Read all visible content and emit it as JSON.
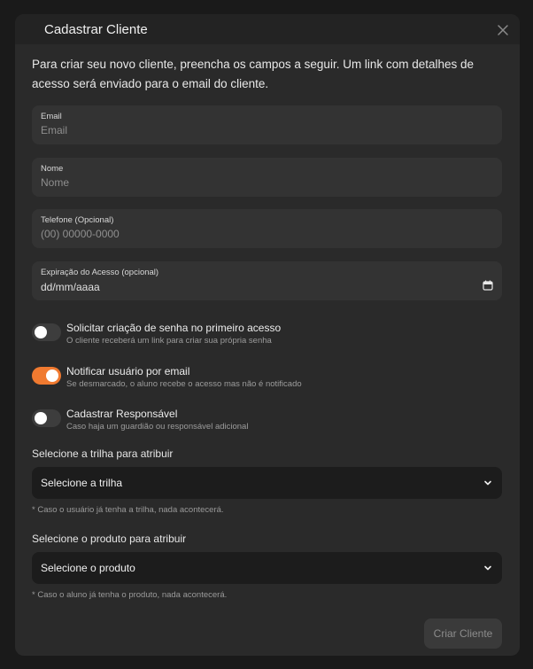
{
  "modal": {
    "title": "Cadastrar Cliente",
    "intro": "Para criar seu novo cliente, preencha os campos a seguir. Um link com detalhes de acesso será enviado para o email do cliente."
  },
  "fields": {
    "email": {
      "label": "Email",
      "placeholder": "Email"
    },
    "name": {
      "label": "Nome",
      "placeholder": "Nome"
    },
    "phone": {
      "label": "Telefone (Opcional)",
      "placeholder": "(00) 00000-0000"
    },
    "expiry": {
      "label": "Expiração do Acesso (opcional)",
      "value": "dd/mm/aaaa"
    }
  },
  "toggles": [
    {
      "title": "Solicitar criação de senha no primeiro acesso",
      "subtitle": "O cliente receberá um link para criar sua própria senha",
      "on": false
    },
    {
      "title": "Notificar usuário por email",
      "subtitle": "Se desmarcado, o aluno recebe o acesso mas não é notificado",
      "on": true
    },
    {
      "title": "Cadastrar Responsável",
      "subtitle": "Caso haja um guardião ou responsável adicional",
      "on": false
    }
  ],
  "trail": {
    "label": "Selecione a trilha para atribuir",
    "value": "Selecione a trilha",
    "note": "* Caso o usuário já tenha a trilha, nada acontecerá."
  },
  "product": {
    "label": "Selecione o produto para atribuir",
    "value": "Selecione o produto",
    "note": "* Caso o aluno já tenha o produto, nada acontecerá."
  },
  "submit_label": "Criar Cliente",
  "colors": {
    "accent": "#f07a30",
    "modal_bg": "#2a2a2a",
    "field_bg": "#333333"
  }
}
